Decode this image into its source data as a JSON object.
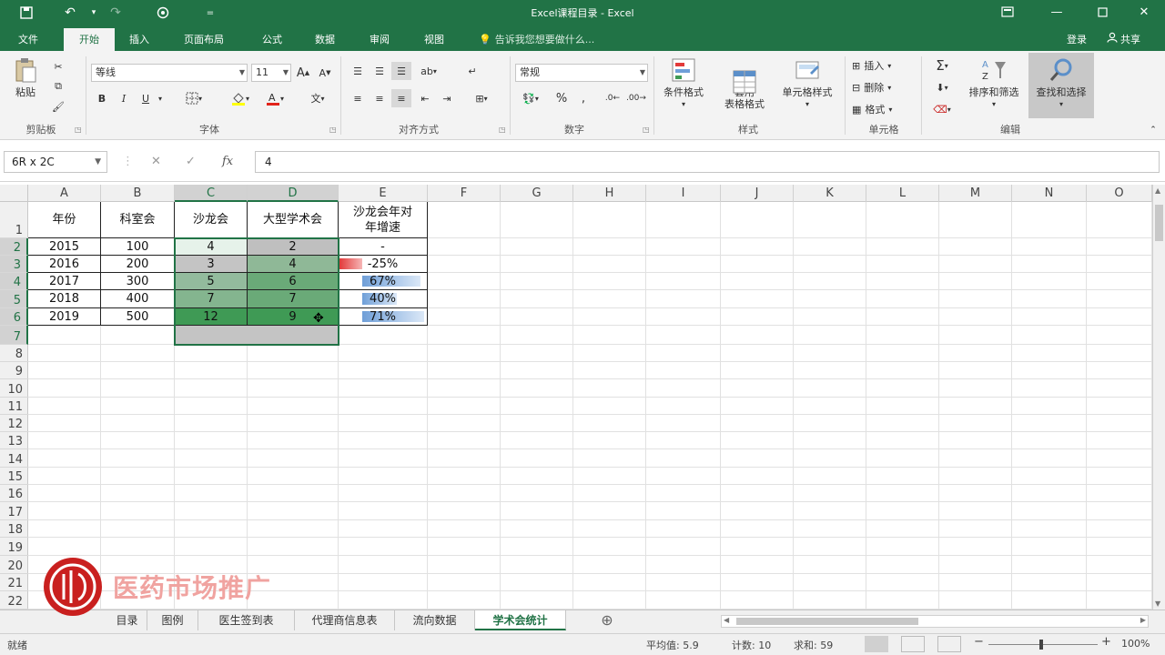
{
  "window": {
    "title": "Excel课程目录 - Excel",
    "qa_icons": [
      "save-icon",
      "undo-icon",
      "redo-icon",
      "touch-mode-icon",
      "customize-icon"
    ]
  },
  "ribbon_tabs": [
    "文件",
    "开始",
    "插入",
    "页面布局",
    "公式",
    "数据",
    "审阅",
    "视图"
  ],
  "active_tab": "开始",
  "tell_me": "告诉我您想要做什么...",
  "account": {
    "login": "登录",
    "share": "共享"
  },
  "ribbon": {
    "clipboard": {
      "paste": "粘贴",
      "label": "剪贴板"
    },
    "font": {
      "name": "等线",
      "size": "11",
      "bold": "B",
      "italic": "I",
      "underline": "U",
      "label": "字体"
    },
    "alignment": {
      "label": "对齐方式"
    },
    "number": {
      "format": "常规",
      "percent": "%",
      "comma": ",",
      "label": "数字"
    },
    "styles": {
      "conditional": "条件格式",
      "table_format": "套用\n表格格式",
      "cell_styles": "单元格样式",
      "label": "样式"
    },
    "cells": {
      "insert": "插入",
      "delete": "删除",
      "format": "格式",
      "label": "单元格"
    },
    "editing": {
      "sort_filter": "排序和筛选",
      "find_select": "查找和选择",
      "label": "编辑"
    }
  },
  "formula_bar": {
    "name_box": "6R x 2C",
    "fx": "fx",
    "value": "4"
  },
  "columns": [
    "A",
    "B",
    "C",
    "D",
    "E",
    "F",
    "G",
    "H",
    "I",
    "J",
    "K",
    "L",
    "M",
    "N",
    "O"
  ],
  "rows": [
    "1",
    "2",
    "3",
    "4",
    "5",
    "6",
    "7",
    "8",
    "9",
    "10",
    "11",
    "12",
    "13",
    "14",
    "15",
    "16",
    "17",
    "18",
    "19",
    "20",
    "21",
    "22"
  ],
  "table": {
    "headers": [
      "年份",
      "科室会",
      "沙龙会",
      "大型学术会",
      "沙龙会年对年增速"
    ],
    "rows": [
      [
        "2015",
        "100",
        "4",
        "2",
        "-"
      ],
      [
        "2016",
        "200",
        "3",
        "4",
        "-25%"
      ],
      [
        "2017",
        "300",
        "5",
        "6",
        "67%"
      ],
      [
        "2018",
        "400",
        "7",
        "7",
        "40%"
      ],
      [
        "2019",
        "500",
        "12",
        "9",
        "71%"
      ]
    ],
    "growth_values": [
      null,
      -25,
      67,
      40,
      71
    ],
    "fill_colors": {
      "C": [
        "#e6f2ea",
        "#c4c4c4",
        "#93bb9d",
        "#84b58f",
        "#3f9a55"
      ],
      "D": [
        "#bfbfbf",
        "#8fb897",
        "#6aaa78",
        "#6aaa78",
        "#3f9a55"
      ]
    },
    "bar_colors": {
      "negative": "#e23a3a",
      "positive": "#6f9fd8"
    }
  },
  "sheets": [
    "目录",
    "图例",
    "医生签到表",
    "代理商信息表",
    "流向数据",
    "学术会统计"
  ],
  "active_sheet": "学术会统计",
  "status": {
    "ready": "就绪",
    "average": "平均值: 5.9",
    "count": "计数: 10",
    "sum": "求和: 59",
    "zoom": "100%"
  },
  "watermark": {
    "text": "医药市场推广"
  },
  "colors": {
    "excel_green": "#217346",
    "selection": "#217346"
  }
}
